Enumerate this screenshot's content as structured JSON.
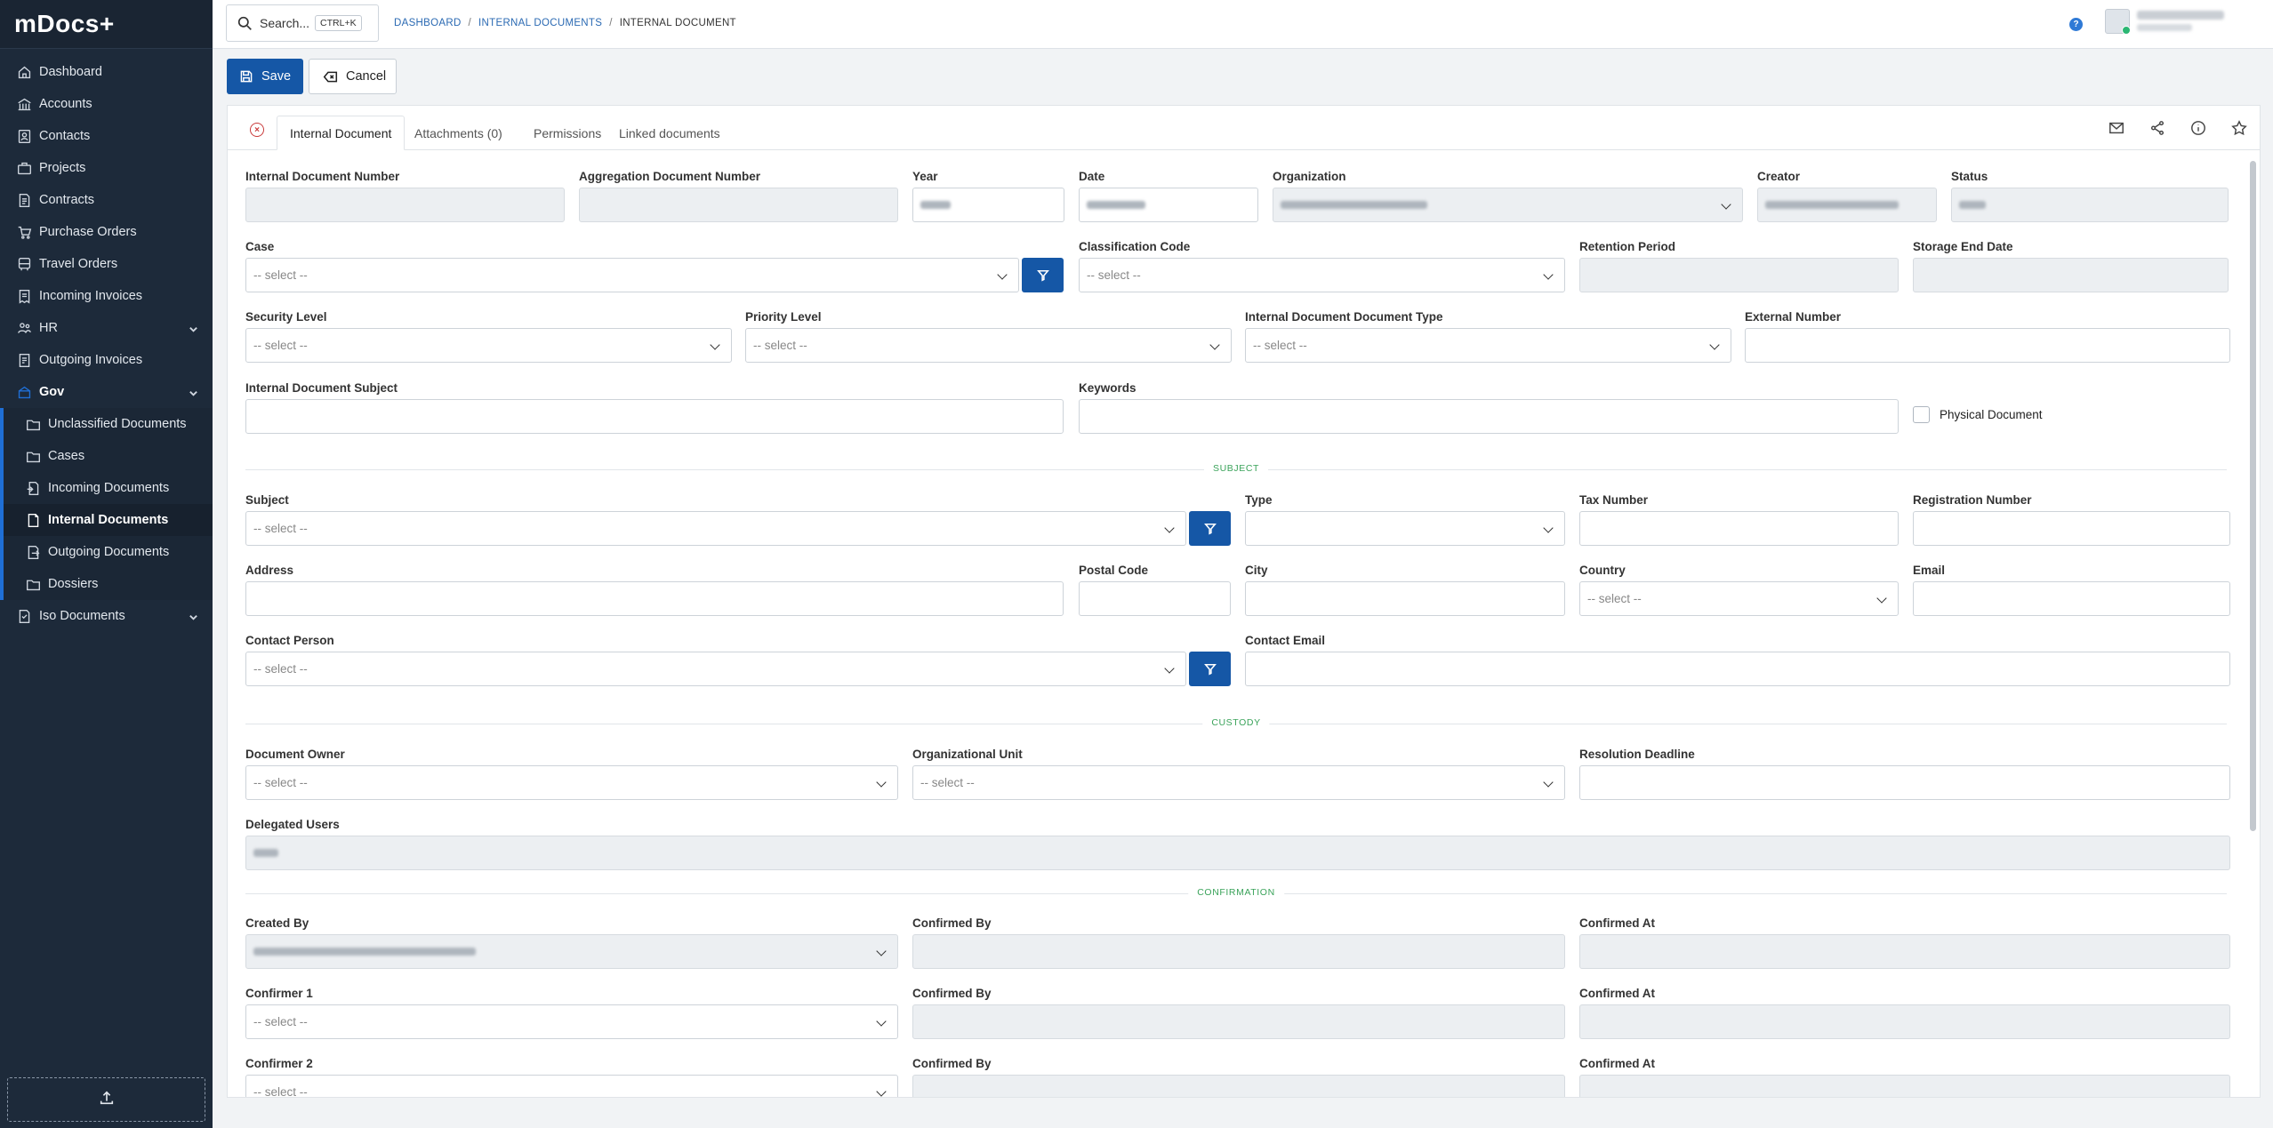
{
  "app": {
    "logo": "mDocs+"
  },
  "sidebar": {
    "items": [
      {
        "label": "Dashboard",
        "icon": "home-icon"
      },
      {
        "label": "Accounts",
        "icon": "bank-icon"
      },
      {
        "label": "Contacts",
        "icon": "contacts-icon"
      },
      {
        "label": "Projects",
        "icon": "briefcase-icon"
      },
      {
        "label": "Contracts",
        "icon": "contract-icon"
      },
      {
        "label": "Purchase Orders",
        "icon": "cart-icon"
      },
      {
        "label": "Travel Orders",
        "icon": "bus-icon"
      },
      {
        "label": "Incoming Invoices",
        "icon": "invoice-in-icon"
      },
      {
        "label": "HR",
        "icon": "people-icon"
      },
      {
        "label": "Outgoing Invoices",
        "icon": "invoice-out-icon"
      },
      {
        "label": "Gov",
        "icon": "gov-icon"
      },
      {
        "label": "Unclassified Documents",
        "icon": "folder-icon"
      },
      {
        "label": "Cases",
        "icon": "folder-icon"
      },
      {
        "label": "Incoming Documents",
        "icon": "document-in-icon"
      },
      {
        "label": "Internal Documents",
        "icon": "document-icon"
      },
      {
        "label": "Outgoing Documents",
        "icon": "document-out-icon"
      },
      {
        "label": "Dossiers",
        "icon": "folder-icon"
      },
      {
        "label": "Iso Documents",
        "icon": "iso-icon"
      }
    ]
  },
  "header": {
    "search_label": "Search...",
    "search_shortcut": "CTRL+K",
    "breadcrumb": [
      "DASHBOARD",
      "INTERNAL DOCUMENTS",
      "INTERNAL DOCUMENT"
    ],
    "help": "?"
  },
  "toolbar": {
    "save": "Save",
    "cancel": "Cancel"
  },
  "tabs": {
    "close": "×",
    "items": [
      "Internal Document",
      "Attachments (0)",
      "Permissions",
      "Linked documents"
    ]
  },
  "form": {
    "placeholder": "-- select --",
    "labels": {
      "internal_document_number": "Internal Document Number",
      "aggregation_document_number": "Aggregation Document Number",
      "year": "Year",
      "date": "Date",
      "organization": "Organization",
      "creator": "Creator",
      "status": "Status",
      "case": "Case",
      "classification_code": "Classification Code",
      "retention_period": "Retention Period",
      "storage_end_date": "Storage End Date",
      "security_level": "Security Level",
      "priority_level": "Priority Level",
      "document_type": "Internal Document Document Type",
      "external_number": "External Number",
      "subject_field": "Internal Document Subject",
      "keywords": "Keywords",
      "physical_document": "Physical Document",
      "subject": "Subject",
      "type": "Type",
      "tax_number": "Tax Number",
      "registration_number": "Registration Number",
      "address": "Address",
      "postal_code": "Postal Code",
      "city": "City",
      "country": "Country",
      "email": "Email",
      "contact_person": "Contact Person",
      "contact_email": "Contact Email",
      "document_owner": "Document Owner",
      "organizational_unit": "Organizational Unit",
      "resolution_deadline": "Resolution Deadline",
      "delegated_users": "Delegated Users",
      "created_by": "Created By",
      "confirmed_by": "Confirmed By",
      "confirmed_at": "Confirmed At",
      "confirmer_1": "Confirmer 1",
      "confirmer_2": "Confirmer 2"
    },
    "sections": {
      "subject": "SUBJECT",
      "custody": "CUSTODY",
      "confirmation": "CONFIRMATION"
    }
  }
}
